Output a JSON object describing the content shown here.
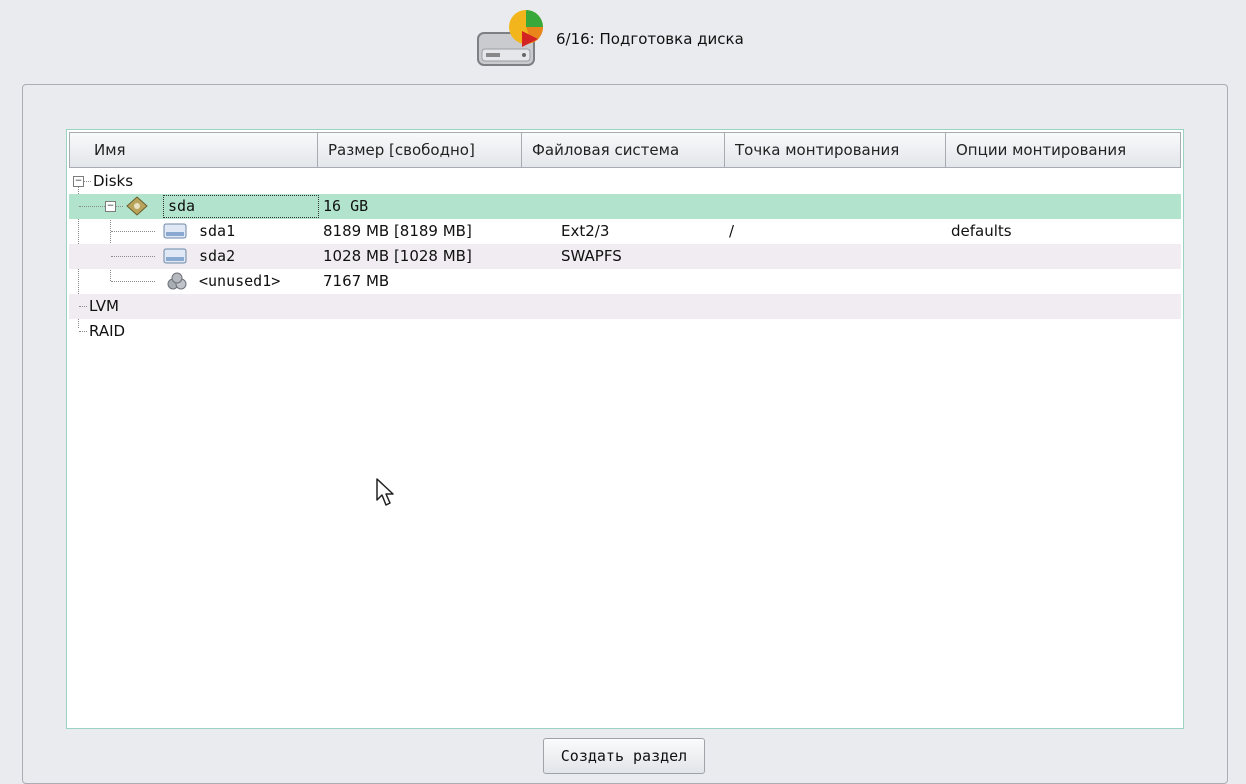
{
  "step": {
    "title": "6/16: Подготовка диска",
    "icon": "disk-partition-icon"
  },
  "table": {
    "columns": [
      "Имя",
      "Размер [свободно]",
      "Файловая система",
      "Точка монтирования",
      "Опции монтирования"
    ]
  },
  "tree": {
    "disks_label": "Disks",
    "sda": {
      "name": "sda",
      "size": "16 GB"
    },
    "sda1": {
      "name": "sda1",
      "size": "8189 MB [8189 MB]",
      "fs": "Ext2/3",
      "mount": "/",
      "options": "defaults"
    },
    "sda2": {
      "name": "sda2",
      "size": "1028 MB [1028 MB]",
      "fs": "SWAPFS"
    },
    "unused1": {
      "name": "<unused1>",
      "size": "7167 MB"
    },
    "lvm_label": "LVM",
    "raid_label": "RAID"
  },
  "buttons": {
    "create_partition": "Создать раздел"
  },
  "colors": {
    "selected_row": "#b2e4cd",
    "alt_row": "#f0ecf1",
    "panel_border": "#9ad3c1"
  }
}
